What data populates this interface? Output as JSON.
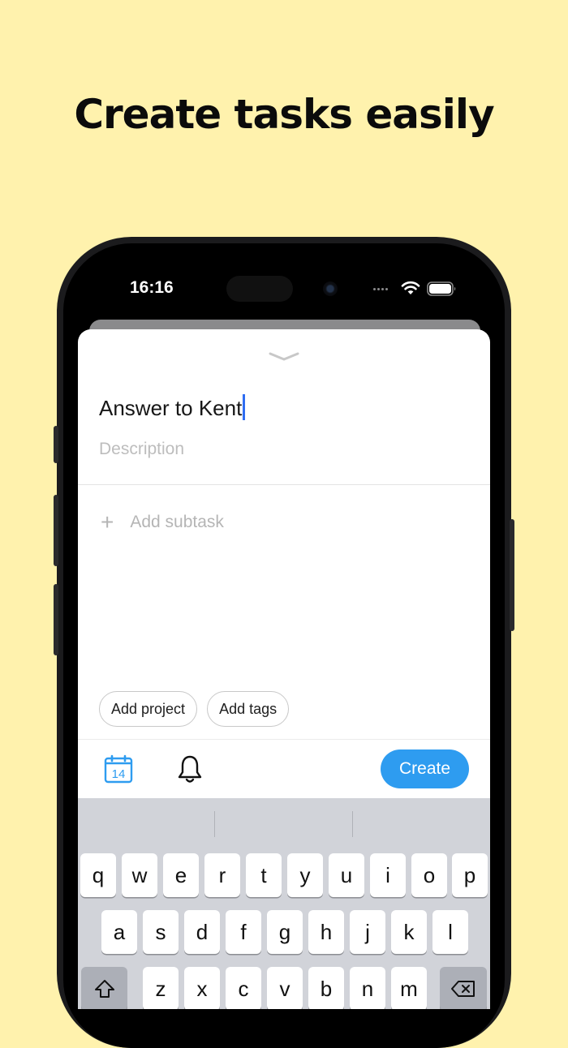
{
  "headline": "Create tasks easily",
  "status_bar": {
    "time": "16:16"
  },
  "task_form": {
    "title_value": "Answer to Kent",
    "description_placeholder": "Description",
    "add_subtask_label": "Add subtask",
    "chips": [
      "Add project",
      "Add tags"
    ],
    "calendar_day": "14",
    "create_label": "Create"
  },
  "keyboard": {
    "row1": [
      "q",
      "w",
      "e",
      "r",
      "t",
      "y",
      "u",
      "i",
      "o",
      "p"
    ],
    "row2": [
      "a",
      "s",
      "d",
      "f",
      "g",
      "h",
      "j",
      "k",
      "l"
    ],
    "row3": [
      "z",
      "x",
      "c",
      "v",
      "b",
      "n",
      "m"
    ]
  },
  "colors": {
    "background": "#fff2ad",
    "accent": "#2e9cf0",
    "cursor": "#2f6df2"
  },
  "icons": {
    "calendar": "calendar-icon",
    "bell": "bell-icon",
    "shift": "shift-icon",
    "backspace": "backspace-icon",
    "grabber": "chevron-down-icon"
  }
}
